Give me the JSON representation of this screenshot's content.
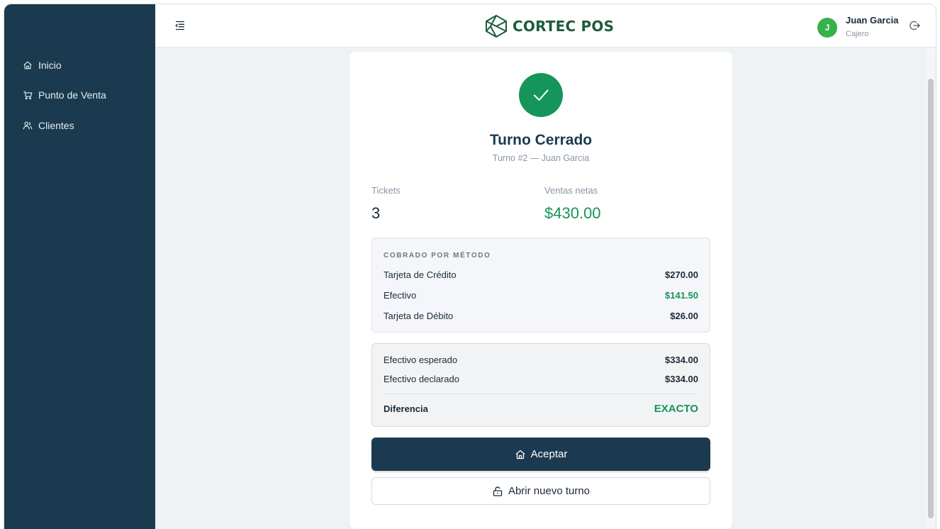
{
  "brand": {
    "name": "CORTEC POS",
    "color": "#1d5c3a"
  },
  "sidebar": {
    "items": [
      {
        "label": "Inicio",
        "icon": "home-icon"
      },
      {
        "label": "Punto de Venta",
        "icon": "cart-icon"
      },
      {
        "label": "Clientes",
        "icon": "users-icon"
      }
    ]
  },
  "header": {
    "user": {
      "initial": "J",
      "name": "Juan Garcia",
      "role": "Cajero"
    }
  },
  "summary": {
    "title": "Turno Cerrado",
    "subtitle": "Turno #2 — Juan Garcia",
    "tickets_label": "Tickets",
    "tickets_value": "3",
    "sales_label": "Ventas netas",
    "sales_value": "$430.00",
    "methods_heading": "COBRADO POR MÉTODO",
    "methods": [
      {
        "name": "Tarjeta de Crédito",
        "amount": "$270.00"
      },
      {
        "name": "Efectivo",
        "amount": "$141.50"
      },
      {
        "name": "Tarjeta de Débito",
        "amount": "$26.00"
      }
    ],
    "cash": {
      "expected_label": "Efectivo esperado",
      "expected_value": "$334.00",
      "declared_label": "Efectivo declarado",
      "declared_value": "$334.00",
      "difference_label": "Diferencia",
      "difference_value": "EXACTO"
    },
    "accept_label": "Aceptar",
    "new_shift_label": "Abrir nuevo turno"
  },
  "colors": {
    "sidebar": "#1b3a4f",
    "success": "#15955a",
    "avatar": "#36b24a"
  }
}
